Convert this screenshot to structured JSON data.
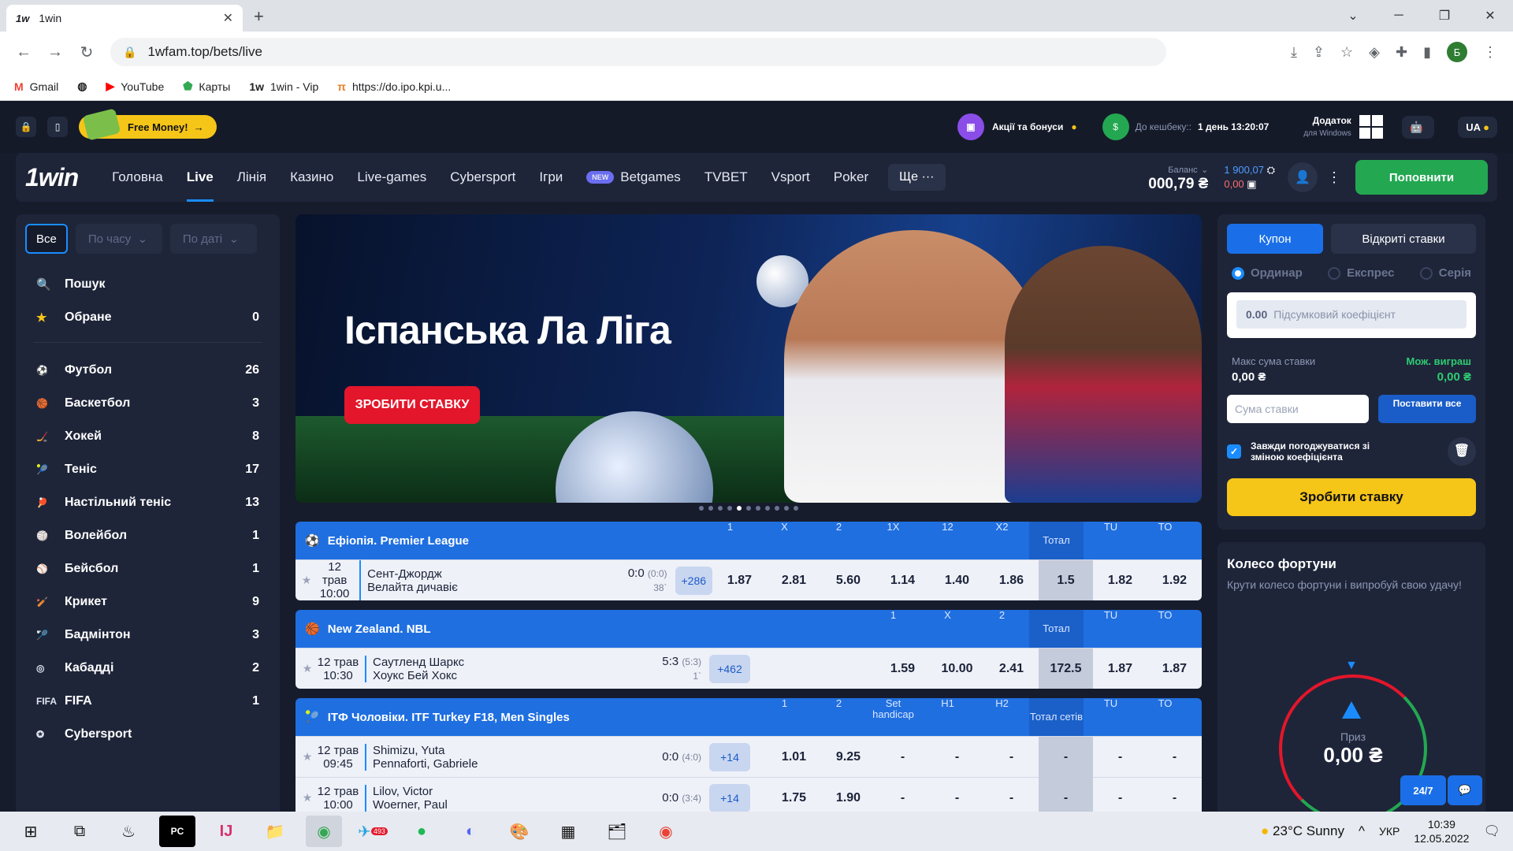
{
  "browser": {
    "tab_title": "1win",
    "tab_favicon": "1w",
    "url": "1wfam.top/bets/live",
    "avatar_letter": "Б",
    "bookmarks": [
      {
        "label": "Gmail",
        "icon": "gmail-icon"
      },
      {
        "label": "",
        "icon": "globe-icon"
      },
      {
        "label": "YouTube",
        "icon": "youtube-icon"
      },
      {
        "label": "Карты",
        "icon": "maps-icon"
      },
      {
        "label": "1win - Vip",
        "icon": "1w-icon"
      },
      {
        "label": "https://do.ipo.kpi.u...",
        "icon": "kpi-icon"
      }
    ]
  },
  "top": {
    "free_money": "Free Money!",
    "promo": "Акції та бонуси",
    "cashback_label": "До кешбеку::",
    "cashback_time": "1 день 13:20:07",
    "app_title": "Додаток",
    "app_sub": "для Windows",
    "lang": "UA"
  },
  "nav": {
    "logo": "1win",
    "items": [
      "Головна",
      "Live",
      "Лінія",
      "Казино",
      "Live-games",
      "Cybersport",
      "Ігри",
      "Betgames",
      "TVBET",
      "Vsport",
      "Poker"
    ],
    "new_badge": "NEW",
    "more": "Ще ···",
    "balance_label": "Баланс",
    "balance_value": "000,79 ₴",
    "bonus_blue": "1 900,07",
    "bonus_red": "0,00",
    "topup": "Поповнити"
  },
  "sidebar": {
    "filters": [
      "Все",
      "По часу",
      "По даті"
    ],
    "search": "Пошук",
    "favorites": {
      "label": "Обране",
      "count": "0"
    },
    "sports": [
      {
        "label": "Футбол",
        "count": "26",
        "icon": "⚽"
      },
      {
        "label": "Баскетбол",
        "count": "3",
        "icon": "🏀"
      },
      {
        "label": "Хокей",
        "count": "8",
        "icon": "🏒"
      },
      {
        "label": "Теніс",
        "count": "17",
        "icon": "🎾"
      },
      {
        "label": "Настільний теніс",
        "count": "13",
        "icon": "🏓"
      },
      {
        "label": "Волейбол",
        "count": "1",
        "icon": "🏐"
      },
      {
        "label": "Бейсбол",
        "count": "1",
        "icon": "⚾"
      },
      {
        "label": "Крикет",
        "count": "9",
        "icon": "🏏"
      },
      {
        "label": "Бадмінтон",
        "count": "3",
        "icon": "🏸"
      },
      {
        "label": "Кабадді",
        "count": "2",
        "icon": "◎"
      },
      {
        "label": "FIFA",
        "count": "1",
        "icon": "FIFA"
      },
      {
        "label": "Cybersport",
        "count": "",
        "icon": "✪"
      }
    ]
  },
  "banner": {
    "title": "Іспанська Ла Ліга",
    "cta": "ЗРОБИТИ СТАВКУ",
    "dots": 11,
    "active_dot": 4
  },
  "leagues": [
    {
      "name": "Ефіопія. Premier League",
      "icon": "⚽",
      "columns": [
        "1",
        "X",
        "2",
        "1X",
        "12",
        "X2",
        "Тотал",
        "TU",
        "TO"
      ],
      "rows": [
        {
          "date": "12 трав",
          "time": "10:00",
          "team1": "Сент-Джордж",
          "team2": "Велайта дичавіє",
          "score": "0:0",
          "sub": "(0:0)",
          "minute": "38`",
          "more": "+286",
          "odds": [
            "1.87",
            "2.81",
            "5.60",
            "1.14",
            "1.40",
            "1.86",
            "1.5",
            "1.82",
            "1.92"
          ]
        }
      ]
    },
    {
      "name": "New Zealand. NBL",
      "icon": "🏀",
      "columns": [
        "1",
        "X",
        "2",
        "Тотал",
        "TU",
        "TO"
      ],
      "rows": [
        {
          "date": "12 трав",
          "time": "10:30",
          "team1": "Саутленд Шаркс",
          "team2": "Хоукс Бей Хокс",
          "score": "5:3",
          "sub": "(5:3)",
          "minute": "1`",
          "more": "+462",
          "odds": [
            "1.59",
            "10.00",
            "2.41",
            "172.5",
            "1.87",
            "1.87"
          ]
        }
      ]
    },
    {
      "name": "ITФ Чоловіки. ITF Turkey F18, Men Singles",
      "icon": "🎾",
      "columns": [
        "1",
        "2",
        "Set handicap",
        "H1",
        "H2",
        "Тотал сетів",
        "TU",
        "TO"
      ],
      "rows": [
        {
          "date": "12 трав",
          "time": "09:45",
          "team1": "Shimizu, Yuta",
          "team2": "Pennaforti, Gabriele",
          "score": "0:0",
          "sub": "(4:0)",
          "minute": "",
          "more": "+14",
          "odds": [
            "1.01",
            "9.25",
            "-",
            "-",
            "-",
            "-",
            "-",
            "-"
          ]
        },
        {
          "date": "12 трав",
          "time": "10:00",
          "team1": "Lilov, Victor",
          "team2": "Woerner, Paul",
          "score": "0:0",
          "sub": "(3:4)",
          "minute": "",
          "more": "+14",
          "odds": [
            "1.75",
            "1.90",
            "-",
            "-",
            "-",
            "-",
            "-",
            "-"
          ]
        }
      ]
    }
  ],
  "coupon": {
    "tab_coupon": "Купон",
    "tab_open": "Відкриті ставки",
    "types": [
      "Ординар",
      "Експрес",
      "Серія"
    ],
    "coef_value": "0.00",
    "coef_label": "Підсумковий коефіцієнт",
    "max_label": "Макс сума ставки",
    "max_value": "0,00 ₴",
    "win_label": "Мож. виграш",
    "win_value": "0,00 ₴",
    "stake_placeholder": "Сума ставки",
    "bet_all": "Поставити все",
    "agree": "Завжди погоджуватися зі зміною коефіцієнта",
    "make_bet": "Зробити ставку"
  },
  "wheel": {
    "title": "Колесо фортуни",
    "desc": "Крути колесо фортуни і випробуй свою удачу!",
    "prize_label": "Приз",
    "prize_value": "0,00 ₴",
    "support": "24/7"
  },
  "taskbar": {
    "weather": "23°C  Sunny",
    "lang": "УКР",
    "time": "10:39",
    "date": "12.05.2022",
    "telegram_badge": "493"
  }
}
